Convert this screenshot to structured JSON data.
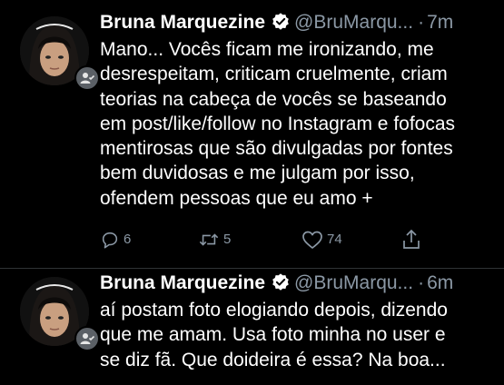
{
  "colors": {
    "background": "#000000",
    "text": "#ffffff",
    "secondary": "#8b98a5",
    "divider": "#2f3336",
    "verified": "#ffffff"
  },
  "tweets": [
    {
      "author_name": "Bruna Marquezine",
      "handle": "@BruMarqu...",
      "separator": "·",
      "time": "7m",
      "lines": [
        "Mano... Vocês ficam me ironizando, me",
        "desrespeitam, criticam cruelmente, criam",
        "teorias na cabeça de vocês se baseando",
        "em post/like/follow no Instagram e fofocas",
        "mentirosas que são divulgadas por fontes",
        "bem duvidosas e me julgam por isso,",
        "ofendem pessoas que eu amo +"
      ],
      "actions": {
        "replies": "6",
        "retweets": "5",
        "likes": "74"
      },
      "icons": [
        "reply-icon",
        "retweet-icon",
        "like-icon",
        "share-icon"
      ]
    },
    {
      "author_name": "Bruna Marquezine",
      "handle": "@BruMarqu...",
      "separator": "·",
      "time": "6m",
      "lines": [
        "aí postam foto elogiando depois, dizendo",
        "que me amam. Usa foto minha no user e",
        "se diz fã. Que doideira é essa? Na boa..."
      ]
    }
  ]
}
